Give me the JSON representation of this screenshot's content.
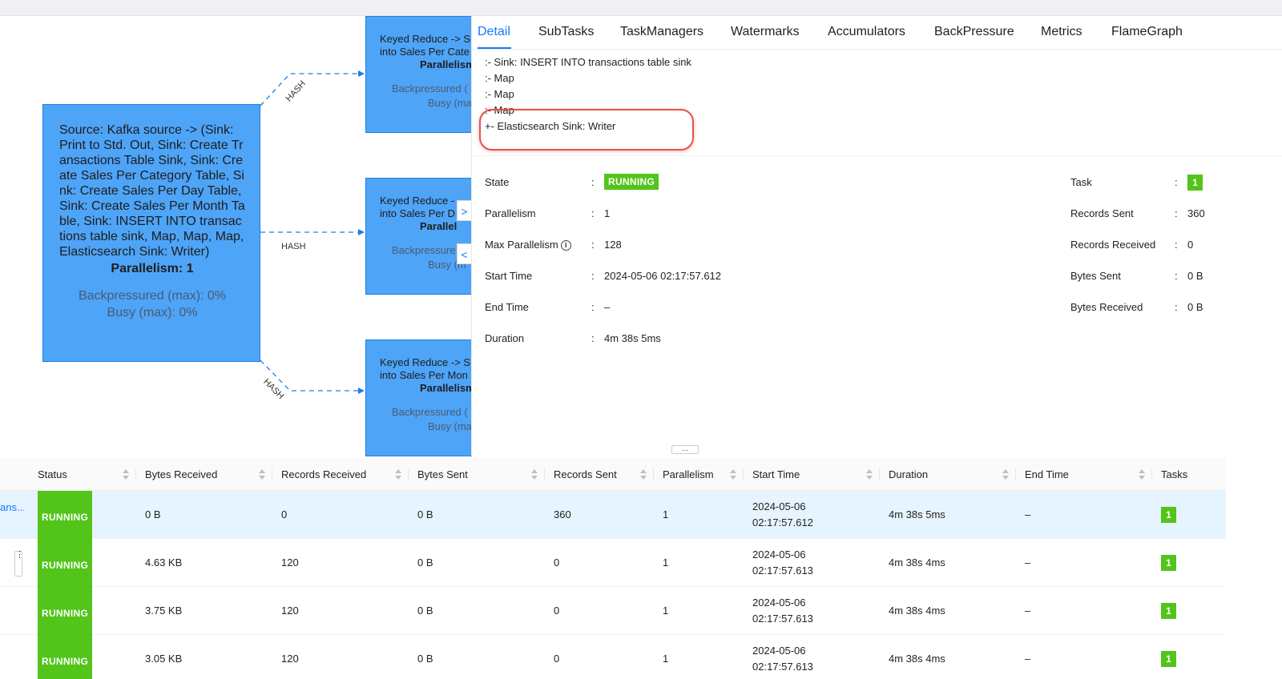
{
  "graph": {
    "source_node": {
      "title": "Source: Kafka source -> (Sink: Print to Std. Out, Sink: Create Transactions Table Sink, Sink: Create Sales Per Category Table, Sink: Create Sales Per Day Table, Sink: Create Sales Per Month Table, Sink: INSERT INTO transactions table sink, Map, Map, Map, Elasticsearch Sink: Writer)",
      "parallelism": "Parallelism: 1",
      "backpressured": "Backpressured (max): 0%",
      "busy": "Busy (max): 0%"
    },
    "nodes": [
      {
        "title_line1": "Keyed Reduce -> S",
        "title_line2": "into Sales Per Cate",
        "parallelism": "Parallelism",
        "backpressured": "Backpressured (",
        "busy": "Busy (max)"
      },
      {
        "title_line1": "Keyed Reduce -",
        "title_line2": "into Sales Per D",
        "parallelism": "Parallel",
        "backpressured": "Backpressure",
        "busy": "Busy (m"
      },
      {
        "title_line1": "Keyed Reduce -> S",
        "title_line2": "into Sales Per Mon",
        "parallelism": "Parallelism",
        "backpressured": "Backpressured (",
        "busy": "Busy (max)"
      }
    ],
    "edge_labels": [
      "HASH",
      "HASH",
      "HASH"
    ],
    "nav_next": ">",
    "nav_prev": "<"
  },
  "drawer": {
    "tabs": [
      "Detail",
      "SubTasks",
      "TaskManagers",
      "Watermarks",
      "Accumulators",
      "BackPressure",
      "Metrics",
      "FlameGraph"
    ],
    "active_tab": "Detail",
    "plan_lines": [
      ":- Sink: INSERT INTO transactions table sink",
      ":- Map",
      ":- Map",
      ":- Map",
      "+- Elasticsearch Sink: Writer"
    ],
    "left_fields": {
      "state_label": "State",
      "state_value": "RUNNING",
      "parallelism_label": "Parallelism",
      "parallelism_value": "1",
      "max_parallelism_label": "Max Parallelism",
      "max_parallelism_value": "128",
      "start_time_label": "Start Time",
      "start_time_value": "2024-05-06 02:17:57.612",
      "end_time_label": "End Time",
      "end_time_value": "–",
      "duration_label": "Duration",
      "duration_value": "4m 38s 5ms"
    },
    "right_fields": {
      "task_label": "Task",
      "task_value": "1",
      "records_sent_label": "Records Sent",
      "records_sent_value": "360",
      "records_received_label": "Records Received",
      "records_received_value": "0",
      "bytes_sent_label": "Bytes Sent",
      "bytes_sent_value": "0 B",
      "bytes_received_label": "Bytes Received",
      "bytes_received_value": "0 B"
    },
    "colon": ":",
    "info_icon": "i"
  },
  "resizer_glyph": "...",
  "table": {
    "headers": [
      "Status",
      "Bytes Received",
      "Records Received",
      "Bytes Sent",
      "Records Sent",
      "Parallelism",
      "Start Time",
      "Duration",
      "End Time",
      "Tasks"
    ],
    "first_row_name": "ans...",
    "rows": [
      {
        "status": "RUNNING",
        "bytes_received": "0 B",
        "records_received": "0",
        "bytes_sent": "0 B",
        "records_sent": "360",
        "parallelism": "1",
        "start_date": "2024-05-06",
        "start_time": "02:17:57.612",
        "duration": "4m 38s 5ms",
        "end_time": "–",
        "tasks": "1"
      },
      {
        "status": "RUNNING",
        "bytes_received": "4.63 KB",
        "records_received": "120",
        "bytes_sent": "0 B",
        "records_sent": "0",
        "parallelism": "1",
        "start_date": "2024-05-06",
        "start_time": "02:17:57.613",
        "duration": "4m 38s 4ms",
        "end_time": "–",
        "tasks": "1"
      },
      {
        "status": "RUNNING",
        "bytes_received": "3.75 KB",
        "records_received": "120",
        "bytes_sent": "0 B",
        "records_sent": "0",
        "parallelism": "1",
        "start_date": "2024-05-06",
        "start_time": "02:17:57.613",
        "duration": "4m 38s 4ms",
        "end_time": "–",
        "tasks": "1"
      },
      {
        "status": "RUNNING",
        "bytes_received": "3.05 KB",
        "records_received": "120",
        "bytes_sent": "0 B",
        "records_sent": "0",
        "parallelism": "1",
        "start_date": "2024-05-06",
        "start_time": "02:17:57.613",
        "duration": "4m 38s 4ms",
        "end_time": "–",
        "tasks": "1"
      }
    ],
    "row_handle_glyph": "⋮"
  },
  "colors": {
    "accent": "#1677ff",
    "node_fill": "#4ea4f7",
    "running_green": "#52c41a",
    "highlight_red": "#e5534b",
    "selected_row": "#e6f4ff"
  }
}
